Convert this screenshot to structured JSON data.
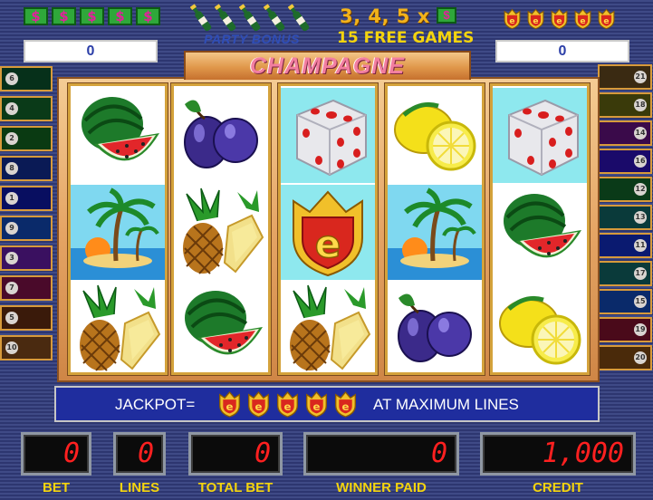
{
  "top": {
    "dollar_symbols": [
      "$",
      "$",
      "$",
      "$",
      "$"
    ],
    "bonus_name": "PARTY BONUS",
    "bonus_multiplier_text": "3, 4, 5 x",
    "bonus_multiplier_symbol": "$",
    "free_games_text": "15 FREE GAMES",
    "left_counter": "0",
    "right_counter": "0",
    "game_title": "CHAMPAGNE"
  },
  "reels": [
    [
      "watermelon",
      "island",
      "pineapple"
    ],
    [
      "plum",
      "pineapple",
      "watermelon"
    ],
    [
      "dice",
      "shield",
      "pineapple"
    ],
    [
      "lemon",
      "island",
      "plum"
    ],
    [
      "dice",
      "watermelon",
      "lemon"
    ]
  ],
  "highlighted_cells": [
    [
      0,
      1
    ],
    [
      2,
      0
    ],
    [
      2,
      1
    ],
    [
      3,
      1
    ],
    [
      4,
      0
    ]
  ],
  "line_indicators": {
    "left": [
      "6",
      "4",
      "2",
      "8",
      "1",
      "9",
      "3",
      "7",
      "5",
      "10"
    ],
    "right": [
      "21",
      "18",
      "14",
      "16",
      "12",
      "13",
      "11",
      "17",
      "15",
      "19",
      "20"
    ],
    "left_colors": [
      "#06301a",
      "#0a3a18",
      "#0a3a12",
      "#0a1a55",
      "#080e60",
      "#0a2a6a",
      "#3a1060",
      "#4a0a2a",
      "#3a1a0a",
      "#4a2a10"
    ],
    "right_colors": [
      "#3a2a12",
      "#3a3a0a",
      "#3a0a4a",
      "#1a0a6a",
      "#0a3a18",
      "#0a3a3a",
      "#0a1a70",
      "#0a3a3a",
      "#0a2a6a",
      "#4a0a1a",
      "#4a2a0a"
    ]
  },
  "jackpot": {
    "label": "JACKPOT=",
    "symbol_count": 5,
    "suffix": "AT MAXIMUM LINES"
  },
  "displays": {
    "bet": {
      "label": "BET",
      "value": "0"
    },
    "lines": {
      "label": "LINES",
      "value": "0"
    },
    "total_bet": {
      "label": "TOTAL BET",
      "value": "0"
    },
    "winner_paid": {
      "label": "WINNER PAID",
      "value": "0"
    },
    "credit": {
      "label": "CREDIT",
      "value": "1,000"
    }
  },
  "colors": {
    "accent_yellow": "#f4d40e",
    "display_red": "#ff2020",
    "jackpot_bar": "#1f2d9e",
    "highlight_cyan": "#8ee8ee"
  }
}
